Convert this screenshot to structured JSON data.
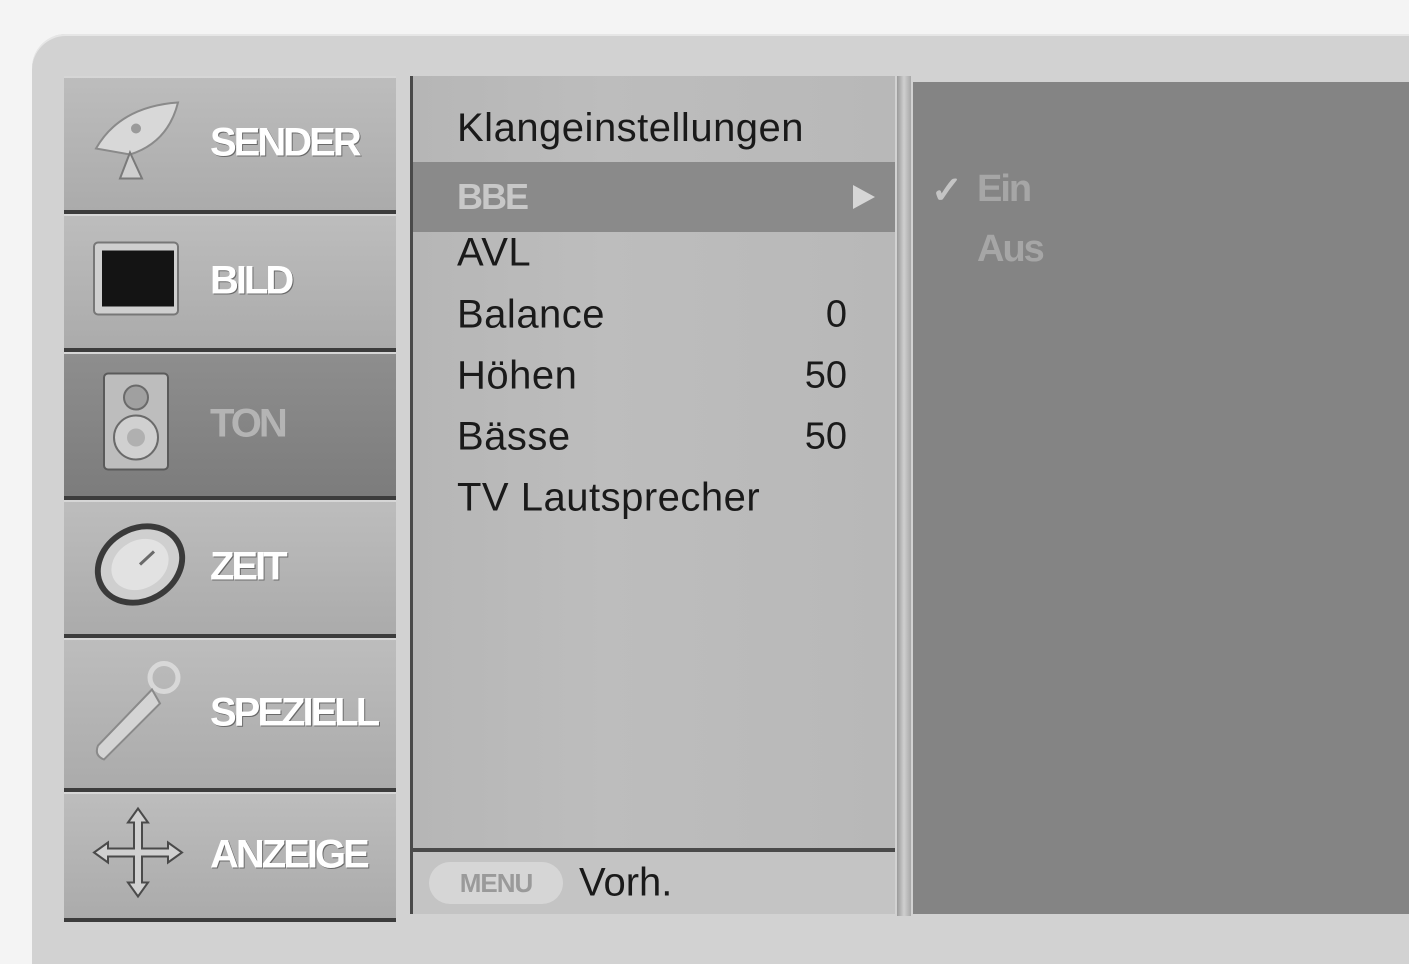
{
  "categories": [
    {
      "label": "SENDER",
      "icon": "satellite-dish-icon",
      "selected": false
    },
    {
      "label": "BILD",
      "icon": "tv-screen-icon",
      "selected": false
    },
    {
      "label": "TON",
      "icon": "speaker-icon",
      "selected": true
    },
    {
      "label": "ZEIT",
      "icon": "clock-icon",
      "selected": false
    },
    {
      "label": "SPEZIELL",
      "icon": "remote-key-icon",
      "selected": false
    },
    {
      "label": "ANZEIGE",
      "icon": "move-arrows-icon",
      "selected": false
    }
  ],
  "submenu": {
    "title": "Klangeinstellungen",
    "items": [
      {
        "name": "BBE",
        "value": "",
        "highlighted": true
      },
      {
        "name": "AVL",
        "value": ""
      },
      {
        "name": "Balance",
        "value": "0"
      },
      {
        "name": "Höhen",
        "value": "50"
      },
      {
        "name": "Bässe",
        "value": "50"
      },
      {
        "name": "TV Lautsprecher",
        "value": ""
      }
    ],
    "footer": {
      "button_label": "MENU",
      "prev_label": "Vorh."
    }
  },
  "options": {
    "check_mark": "✓",
    "items": [
      {
        "label": "Ein",
        "checked": true
      },
      {
        "label": "Aus",
        "checked": false
      }
    ]
  },
  "colors": {
    "highlight": "#8a8a8a",
    "panel": "#bababa",
    "options_bg": "#848484"
  }
}
